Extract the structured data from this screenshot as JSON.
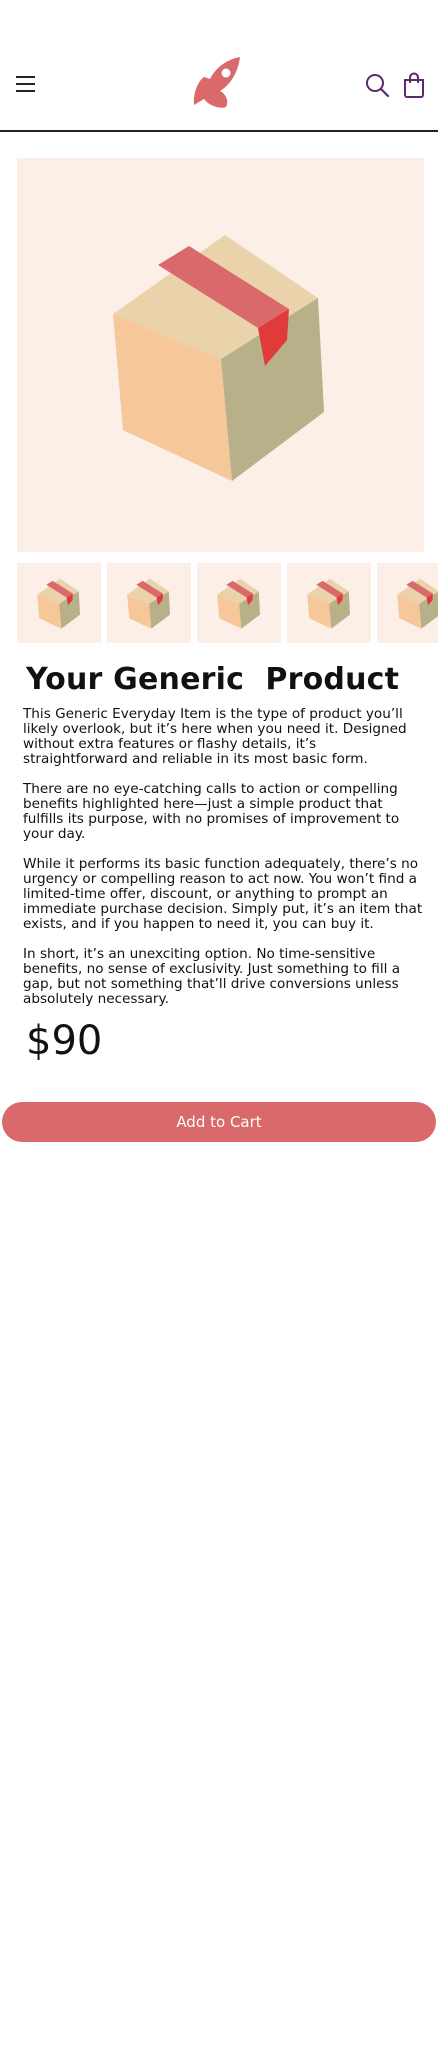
{
  "header": {
    "menu_icon": "hamburger-menu-icon",
    "logo_icon": "rocket-logo-icon",
    "search_icon": "search-icon",
    "bag_icon": "shopping-bag-icon",
    "logo_color": "#d9696a",
    "icon_color": "#5a2a6a"
  },
  "product": {
    "image_icon": "cardboard-box-icon",
    "thumbnail_count": 5,
    "title": "Your Generic  Product",
    "description": [
      "This Generic Everyday Item is the type of product you’ll likely overlook, but it’s here when you need it. Designed without extra features or flashy details, it’s straightforward and reliable in its most basic form.",
      "There are no eye-catching calls to action or compelling benefits highlighted here—just a simple product that fulfills its purpose, with no promises of improvement to your day.",
      "While it performs its basic function adequately, there’s no urgency or compelling reason to act now. You won’t find a limited-time offer, discount, or anything to prompt an immediate purchase decision. Simply put, it’s an item that exists, and if you happen to need it, you can buy it.",
      "In short, it’s an unexciting option. No time-sensitive benefits, no sense of exclusivity. Just something to fill a gap, but not something that’ll drive conversions unless absolutely necessary."
    ],
    "price": "$90",
    "add_to_cart_label": "Add to Cart",
    "button_color": "#d9696a",
    "image_background": "#fcefe8"
  }
}
